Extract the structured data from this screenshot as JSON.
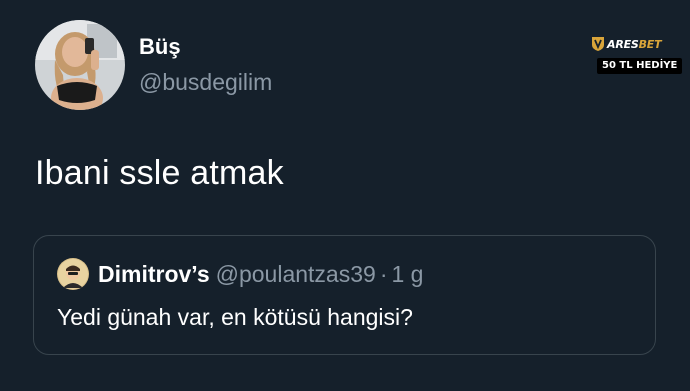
{
  "author": {
    "display_name": "Büş",
    "handle": "@busdegilim"
  },
  "sponsor": {
    "brand_primary": "ARES",
    "brand_accent": "BET",
    "badge": "50 TL HEDİYE",
    "accent_color": "#d9a53a"
  },
  "tweet": {
    "text": "Ibani ssle atmak"
  },
  "quoted_tweet": {
    "display_name": "Dimitrov’s",
    "handle": "@poulantzas39",
    "separator": "·",
    "time": "1 g",
    "text": "Yedi günah var, en kötüsü hangisi?"
  },
  "colors": {
    "background": "#15202b",
    "text_primary": "#ffffff",
    "text_secondary": "#8b98a5",
    "border": "#38444d"
  }
}
